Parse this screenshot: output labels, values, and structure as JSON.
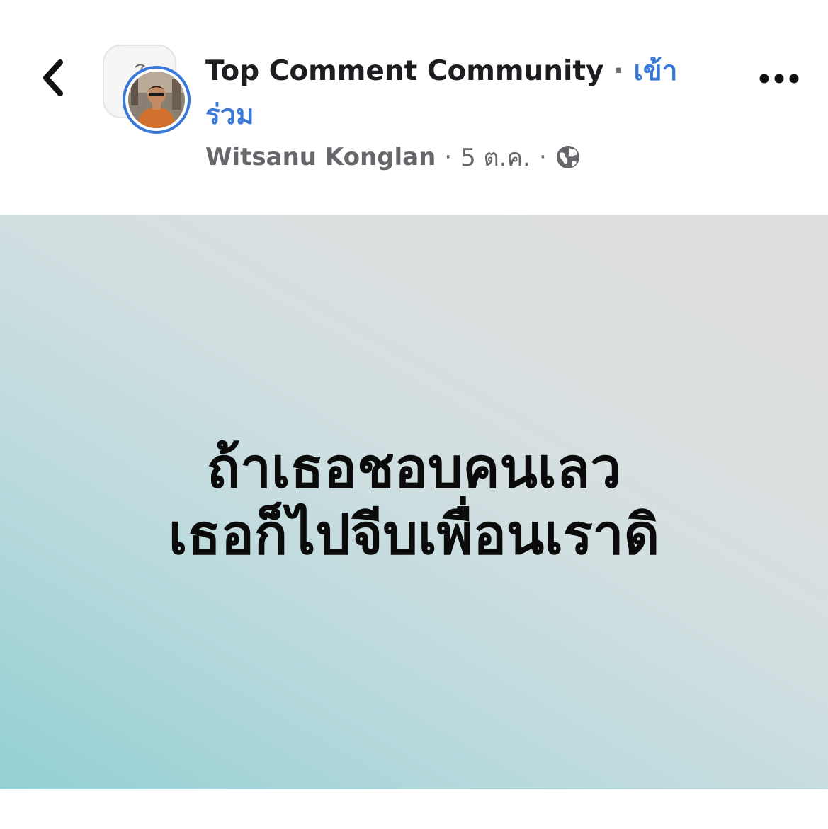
{
  "header": {
    "group_name": "Top Comment Community",
    "separator": "·",
    "join_label_line1": "เข้า",
    "join_label_line2": "ร่วม",
    "author": "Witsanu Konglan",
    "meta_sep": "·",
    "date": "5 ต.ค.",
    "privacy_icon": "globe-icon",
    "back_icon": "chevron-left-icon",
    "more_icon": "more-horizontal-icon"
  },
  "post": {
    "text_line1": "ถ้าเธอชอบคนเลว",
    "text_line2": "เธอก็ไปจีบเพื่อนเราดิ"
  },
  "colors": {
    "accent": "#3a78d8",
    "text_primary": "#1c1e21",
    "text_secondary": "#65676b",
    "gradient_start": "#93d0d4",
    "gradient_end": "#dedede"
  }
}
